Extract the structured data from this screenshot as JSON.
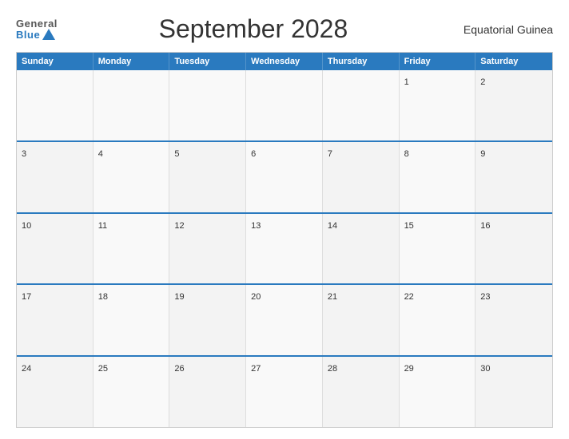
{
  "header": {
    "logo_general": "General",
    "logo_blue": "Blue",
    "title": "September 2028",
    "country": "Equatorial Guinea"
  },
  "calendar": {
    "day_headers": [
      "Sunday",
      "Monday",
      "Tuesday",
      "Wednesday",
      "Thursday",
      "Friday",
      "Saturday"
    ],
    "weeks": [
      [
        {
          "day": "",
          "empty": true
        },
        {
          "day": "",
          "empty": true
        },
        {
          "day": "",
          "empty": true
        },
        {
          "day": "",
          "empty": true
        },
        {
          "day": "",
          "empty": true
        },
        {
          "day": "1",
          "empty": false
        },
        {
          "day": "2",
          "empty": false
        }
      ],
      [
        {
          "day": "3",
          "empty": false
        },
        {
          "day": "4",
          "empty": false
        },
        {
          "day": "5",
          "empty": false
        },
        {
          "day": "6",
          "empty": false
        },
        {
          "day": "7",
          "empty": false
        },
        {
          "day": "8",
          "empty": false
        },
        {
          "day": "9",
          "empty": false
        }
      ],
      [
        {
          "day": "10",
          "empty": false
        },
        {
          "day": "11",
          "empty": false
        },
        {
          "day": "12",
          "empty": false
        },
        {
          "day": "13",
          "empty": false
        },
        {
          "day": "14",
          "empty": false
        },
        {
          "day": "15",
          "empty": false
        },
        {
          "day": "16",
          "empty": false
        }
      ],
      [
        {
          "day": "17",
          "empty": false
        },
        {
          "day": "18",
          "empty": false
        },
        {
          "day": "19",
          "empty": false
        },
        {
          "day": "20",
          "empty": false
        },
        {
          "day": "21",
          "empty": false
        },
        {
          "day": "22",
          "empty": false
        },
        {
          "day": "23",
          "empty": false
        }
      ],
      [
        {
          "day": "24",
          "empty": false
        },
        {
          "day": "25",
          "empty": false
        },
        {
          "day": "26",
          "empty": false
        },
        {
          "day": "27",
          "empty": false
        },
        {
          "day": "28",
          "empty": false
        },
        {
          "day": "29",
          "empty": false
        },
        {
          "day": "30",
          "empty": false
        }
      ]
    ]
  }
}
